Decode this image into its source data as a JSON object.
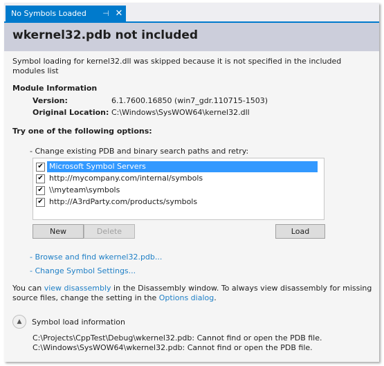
{
  "tab": {
    "label": "No Symbols Loaded",
    "pin_icon": "⊣",
    "close_icon": "✕"
  },
  "header": {
    "title": "wkernel32.pdb not included"
  },
  "description": "Symbol loading for kernel32.dll was skipped because it is not specified in the included modules list",
  "module_info": {
    "title": "Module Information",
    "version_label": "Version:",
    "version_value": "6.1.7600.16850 (win7_gdr.110715-1503)",
    "location_label": "Original Location:",
    "location_value": "C:\\Windows\\SysWOW64\\kernel32.dll"
  },
  "options": {
    "title": "Try one of the following options:",
    "retry_text": "- Change existing PDB and binary search paths and retry:",
    "search_paths": [
      {
        "label": "Microsoft Symbol Servers",
        "checked": true,
        "selected": true
      },
      {
        "label": "http://mycompany.com/internal/symbols",
        "checked": true,
        "selected": false
      },
      {
        "label": "\\\\myteam\\symbols",
        "checked": true,
        "selected": false
      },
      {
        "label": "http://A3rdParty.com/products/symbols",
        "checked": true,
        "selected": false
      }
    ],
    "check_glyph": "✔",
    "new_label": "New",
    "delete_label": "Delete",
    "load_label": "Load",
    "browse_link": "- Browse and find wkernel32.pdb...",
    "settings_link": "- Change Symbol Settings..."
  },
  "disassembly": {
    "part1": "You can ",
    "link1": "view disassembly",
    "part2": " in the Disassembly window. To always view disassembly for missing source files, change the setting in the ",
    "link2": "Options dialog",
    "part3": "."
  },
  "symbol_load": {
    "title": "Symbol load information",
    "chevron_icon": "▲",
    "lines": [
      "C:\\Projects\\CppTest\\Debug\\wkernel32.pdb: Cannot find or open the PDB file.",
      "C:\\Windows\\SysWOW64\\wkernel32.pdb: Cannot find or open the PDB file."
    ]
  },
  "colors": {
    "accent": "#007acc",
    "header_band": "#cccedb",
    "selection": "#3399ff",
    "link": "#1e7fc6"
  }
}
